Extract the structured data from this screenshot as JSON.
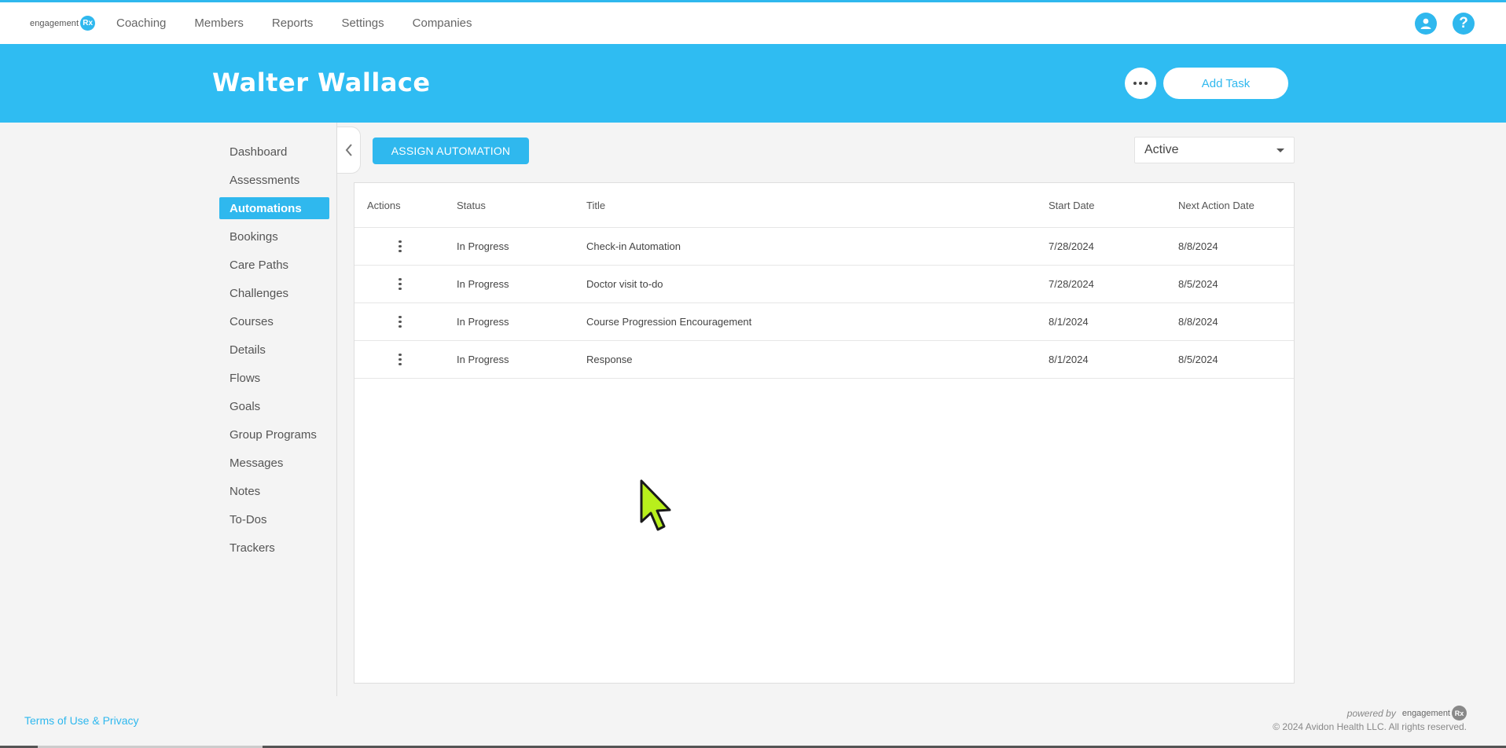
{
  "brand": {
    "logo_text": "engagement",
    "logo_badge": "Rx",
    "accent_color": "#2fb8ee"
  },
  "nav": {
    "items": [
      "Coaching",
      "Members",
      "Reports",
      "Settings",
      "Companies"
    ]
  },
  "top_icons": [
    "user-icon",
    "help-icon"
  ],
  "header": {
    "member_name": "Walter Wallace",
    "add_task_label": "Add Task"
  },
  "sidebar": {
    "items": [
      {
        "label": "Dashboard",
        "active": false
      },
      {
        "label": "Assessments",
        "active": false
      },
      {
        "label": "Automations",
        "active": true
      },
      {
        "label": "Bookings",
        "active": false
      },
      {
        "label": "Care Paths",
        "active": false
      },
      {
        "label": "Challenges",
        "active": false
      },
      {
        "label": "Courses",
        "active": false
      },
      {
        "label": "Details",
        "active": false
      },
      {
        "label": "Flows",
        "active": false
      },
      {
        "label": "Goals",
        "active": false
      },
      {
        "label": "Group Programs",
        "active": false
      },
      {
        "label": "Messages",
        "active": false
      },
      {
        "label": "Notes",
        "active": false
      },
      {
        "label": "To-Dos",
        "active": false
      },
      {
        "label": "Trackers",
        "active": false
      }
    ]
  },
  "toolbar": {
    "assign_label": "ASSIGN AUTOMATION",
    "filter_value": "Active"
  },
  "table": {
    "columns": [
      "Actions",
      "Status",
      "Title",
      "Start Date",
      "Next Action Date"
    ],
    "rows": [
      {
        "status": "In Progress",
        "title": "Check-in Automation",
        "start": "7/28/2024",
        "next": "8/8/2024"
      },
      {
        "status": "In Progress",
        "title": "Doctor visit to-do",
        "start": "7/28/2024",
        "next": "8/5/2024"
      },
      {
        "status": "In Progress",
        "title": "Course Progression Encouragement",
        "start": "8/1/2024",
        "next": "8/8/2024"
      },
      {
        "status": "In Progress",
        "title": "Response",
        "start": "8/1/2024",
        "next": "8/5/2024"
      }
    ]
  },
  "footer": {
    "terms_label": "Terms of Use & Privacy",
    "powered_by": "powered by",
    "powered_logo_text": "engagement",
    "powered_logo_badge": "Rx",
    "copyright": "© 2024 Avidon Health LLC. All rights reserved."
  }
}
